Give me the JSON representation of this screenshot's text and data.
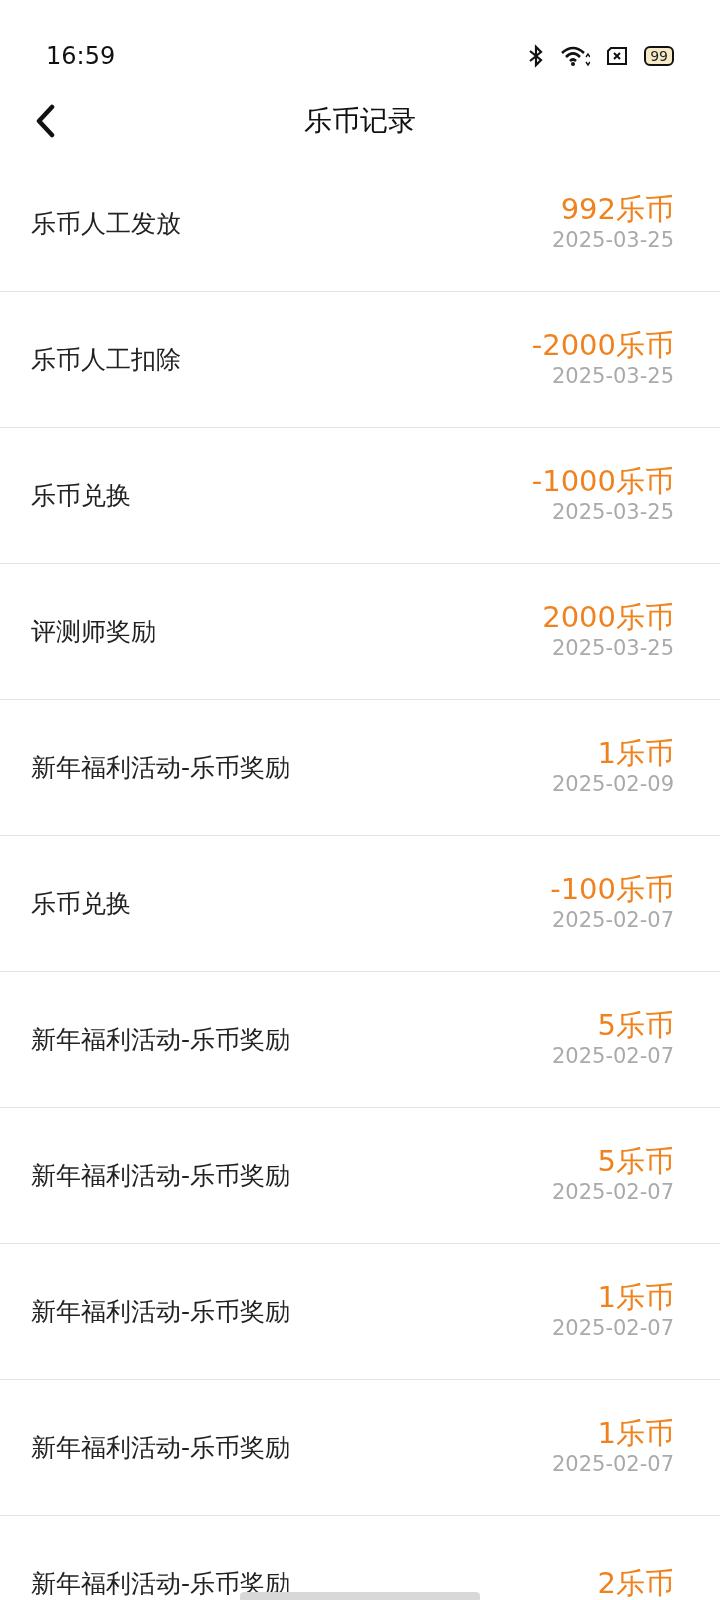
{
  "status_bar": {
    "time": "16:59",
    "battery": "99"
  },
  "header": {
    "title": "乐币记录"
  },
  "records": [
    {
      "label": "乐币人工发放",
      "amount": "992乐币",
      "date": "2025-03-25"
    },
    {
      "label": "乐币人工扣除",
      "amount": "-2000乐币",
      "date": "2025-03-25"
    },
    {
      "label": "乐币兑换",
      "amount": "-1000乐币",
      "date": "2025-03-25"
    },
    {
      "label": "评测师奖励",
      "amount": "2000乐币",
      "date": "2025-03-25"
    },
    {
      "label": "新年福利活动-乐币奖励",
      "amount": "1乐币",
      "date": "2025-02-09"
    },
    {
      "label": "乐币兑换",
      "amount": "-100乐币",
      "date": "2025-02-07"
    },
    {
      "label": "新年福利活动-乐币奖励",
      "amount": "5乐币",
      "date": "2025-02-07"
    },
    {
      "label": "新年福利活动-乐币奖励",
      "amount": "5乐币",
      "date": "2025-02-07"
    },
    {
      "label": "新年福利活动-乐币奖励",
      "amount": "1乐币",
      "date": "2025-02-07"
    },
    {
      "label": "新年福利活动-乐币奖励",
      "amount": "1乐币",
      "date": "2025-02-07"
    },
    {
      "label": "新年福利活动-乐币奖励",
      "amount": "2乐币"
    }
  ]
}
